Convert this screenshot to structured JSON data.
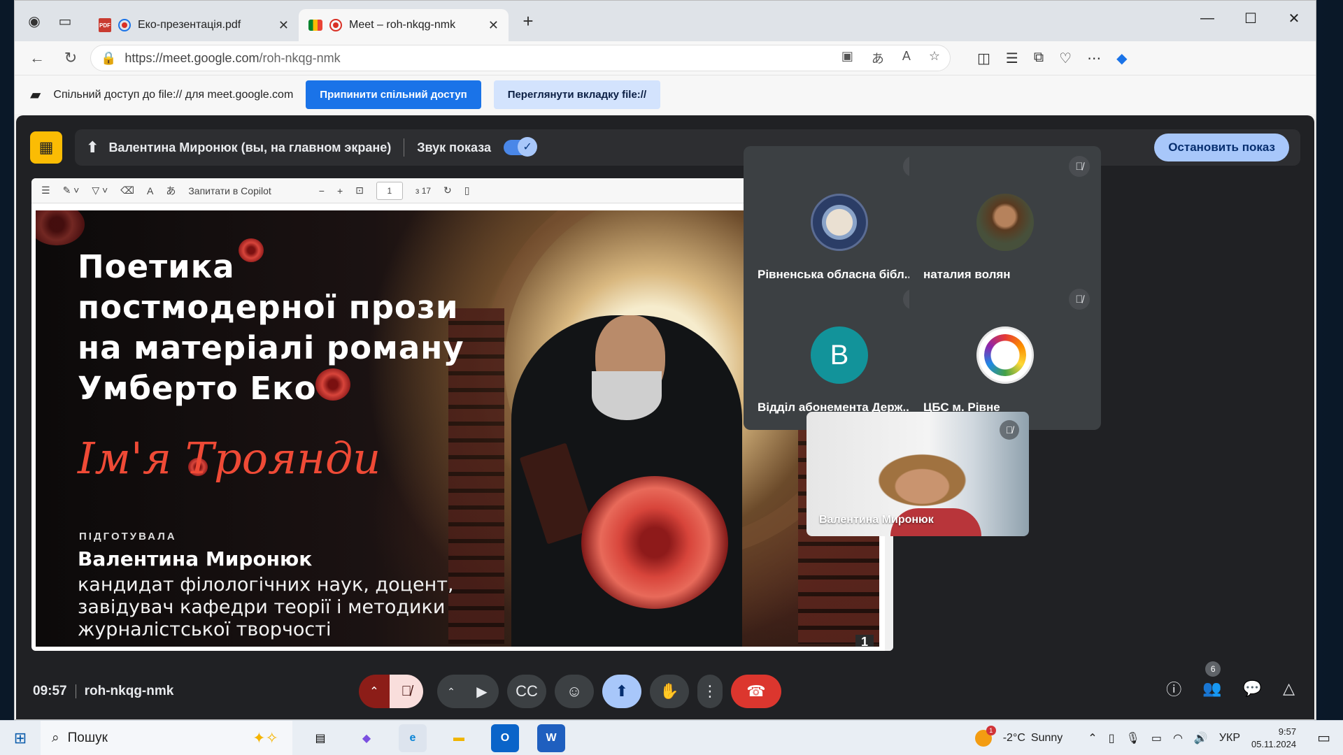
{
  "tabs": [
    {
      "title": "Еко-презентація.pdf"
    },
    {
      "title": "Meet – roh-nkqg-nmk"
    }
  ],
  "address": {
    "url_host": "https://meet.google.com",
    "url_path": "/roh-nkqg-nmk"
  },
  "infobar": {
    "message": "Спільний доступ до file:// для meet.google.com",
    "stop_label": "Припинити спільний доступ",
    "view_label": "Переглянути вкладку file://"
  },
  "presenting": {
    "presenter": "Валентина Миронюк (вы, на главном экране)",
    "audio_label": "Звук показа",
    "stop_label": "Остановить показ"
  },
  "pdf_toolbar": {
    "ask_copilot": "Запитати в Copilot",
    "page": "1",
    "page_total": "з 17"
  },
  "slide": {
    "title_lines": [
      "Поетика",
      "постмодерної прози",
      "на матеріалі роману",
      "Умберто Еко"
    ],
    "script_title": "Ім'я Троянди",
    "prepared_label": "ПІДГОТУВАЛА",
    "author": "Валентина Миронюк",
    "bio_lines": [
      "кандидат філологічних наук, доцент,",
      "завідувач кафедри теорії і методики",
      "журналістської творчості"
    ],
    "page_number": "1"
  },
  "participants": [
    {
      "name": "Рівненська обласна бібліотека",
      "display": "Рівненська обласна бібл..."
    },
    {
      "name": "наталия волян",
      "display": "наталия волян"
    },
    {
      "name": "Відділ абонемента Державної",
      "display": "Відділ абонемента Держ...",
      "initial": "В"
    },
    {
      "name": "ЦБС м. Рівне",
      "display": "ЦБС м. Рівне"
    }
  ],
  "self_video": {
    "name": "Валентина Миронюк"
  },
  "call": {
    "time": "09:57",
    "code": "roh-nkqg-nmk",
    "people_count": "6"
  },
  "taskbar": {
    "search_placeholder": "Пошук",
    "weather_temp": "-2°C",
    "weather_text": "Sunny",
    "lang": "УКР",
    "time": "9:57",
    "date": "05.11.2024"
  },
  "colors": {
    "accent": "#1a73e8",
    "meet_bg": "#202124",
    "tile_bg": "#3c4043",
    "end_call": "#dc362e",
    "present_badge": "#fbbc04"
  }
}
